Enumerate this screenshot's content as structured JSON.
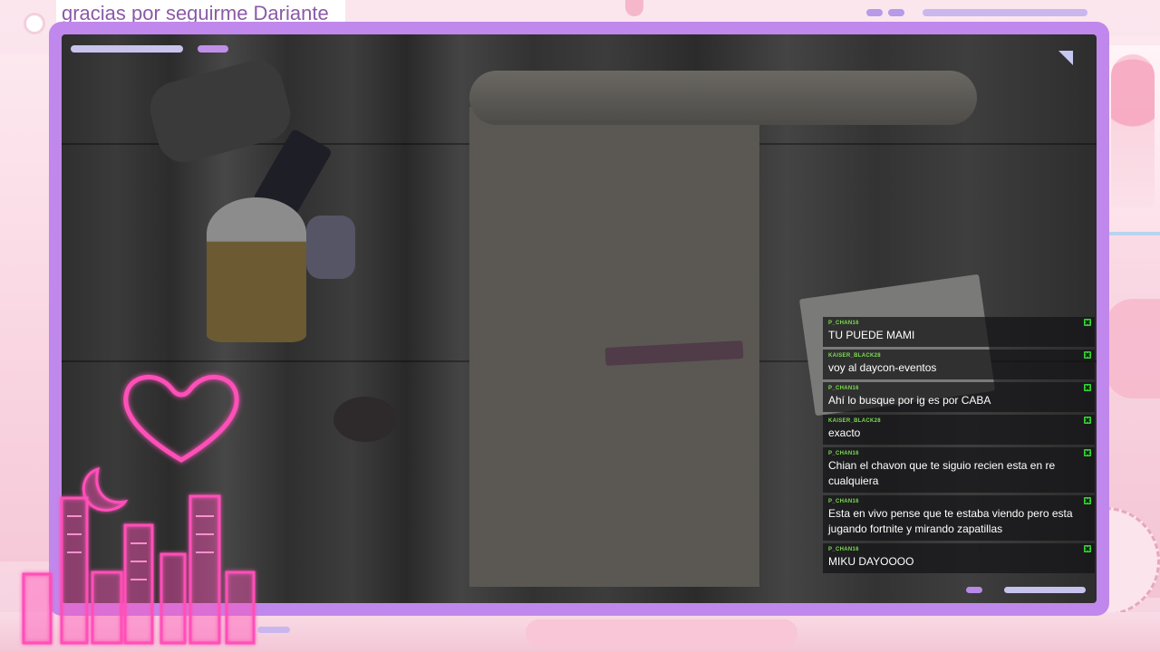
{
  "overlay": {
    "follow_message": "gracias por seguirme Dariante_"
  },
  "chat": {
    "messages": [
      {
        "user": "P_CHAN16",
        "text": "TU PUEDE MAMI"
      },
      {
        "user": "KAISER_BLACK28",
        "text": "voy al daycon-eventos"
      },
      {
        "user": "P_CHAN16",
        "text": "Ahí lo busque por ig es por CABA"
      },
      {
        "user": "KAISER_BLACK28",
        "text": "exacto"
      },
      {
        "user": "P_CHAN16",
        "text": "Chian el chavon que te siguio recien esta en re cualquiera"
      },
      {
        "user": "P_CHAN16",
        "text": "Esta en vivo pense que te estaba viendo pero esta jugando fortnite y mirando zapatillas"
      },
      {
        "user": "P_CHAN16",
        "text": "MIKU DAYOOOO"
      }
    ]
  },
  "colors": {
    "frame": "#c088ec",
    "username": "#7cdf4f",
    "neon": "#ff4fb8",
    "background": "#fbe6ee"
  },
  "icons": [
    "moderator-check-icon",
    "neon-heart-icon",
    "neon-moon-icon",
    "neon-city-icon"
  ]
}
